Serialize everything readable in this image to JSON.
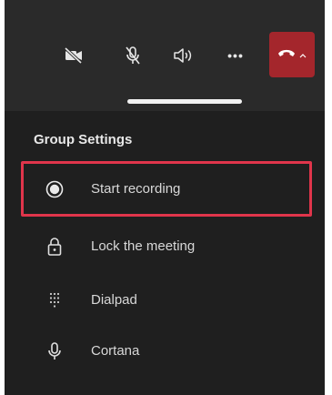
{
  "call_controls": {
    "video_icon": "video-off-icon",
    "mic_icon": "mic-off-icon",
    "speaker_icon": "speaker-icon",
    "more_label": "•••",
    "hangup_icon": "hang-up-icon",
    "hangup_color": "#a4262c"
  },
  "group_settings": {
    "title": "Group Settings",
    "items": [
      {
        "label": "Start recording",
        "icon": "record-icon"
      },
      {
        "label": "Lock the meeting",
        "icon": "lock-icon"
      },
      {
        "label": "Dialpad",
        "icon": "dialpad-icon"
      },
      {
        "label": "Cortana",
        "icon": "microphone-icon"
      }
    ],
    "highlight_color": "#e0354b"
  }
}
